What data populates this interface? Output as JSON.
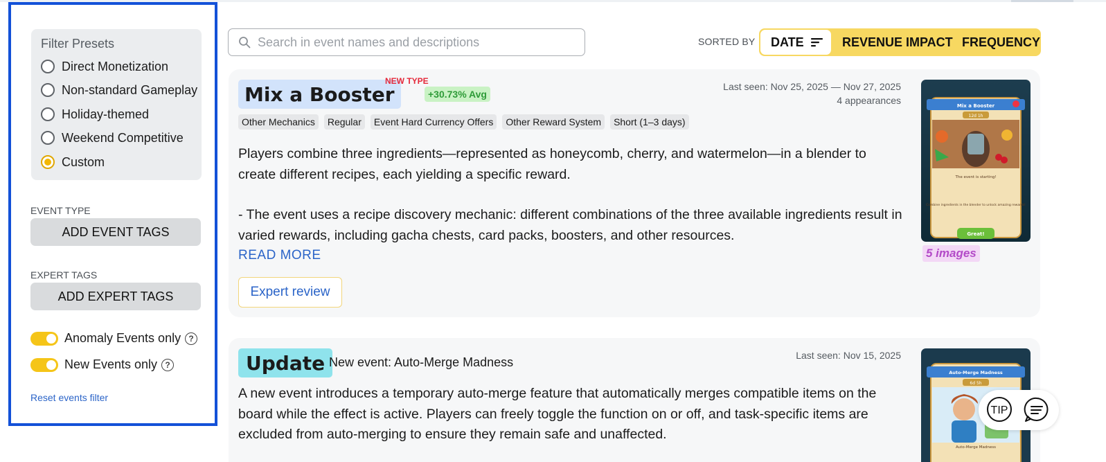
{
  "sidebar": {
    "presets_title": "Filter Presets",
    "presets": [
      {
        "label": "Direct Monetization",
        "checked": false
      },
      {
        "label": "Non-standard Gameplay",
        "checked": false
      },
      {
        "label": "Holiday-themed",
        "checked": false
      },
      {
        "label": "Weekend Competitive",
        "checked": false
      },
      {
        "label": "Custom",
        "checked": true
      }
    ],
    "event_type_label": "EVENT TYPE",
    "add_event_tags": "ADD EVENT TAGS",
    "expert_tags_label": "EXPERT TAGS",
    "add_expert_tags": "ADD EXPERT TAGS",
    "toggles": [
      {
        "label": "Anomaly Events only",
        "on": true
      },
      {
        "label": "New Events only",
        "on": true
      }
    ],
    "help_glyph": "?",
    "reset_link": "Reset events filter"
  },
  "search": {
    "placeholder": "Search in event names and descriptions",
    "value": ""
  },
  "sort": {
    "label": "SORTED BY",
    "options": [
      "DATE",
      "REVENUE IMPACT",
      "FREQUENCY"
    ],
    "active": "DATE"
  },
  "events": [
    {
      "title": "Mix a Booster",
      "badge": "NEW TYPE",
      "impact": "+30.73% Avg",
      "last_seen": "Last seen: Nov 25, 2025 — Nov 27, 2025",
      "appearances": "4 appearances",
      "tags": [
        "Other Mechanics",
        "Regular",
        "Event Hard Currency Offers",
        "Other Reward System",
        "Short (1–3 days)"
      ],
      "description_p1": "Players combine three ingredients—represented as honeycomb, cherry, and watermelon—in a blender to create different recipes, each yielding a specific reward.",
      "description_p2": "- The event uses a recipe discovery mechanic: different combinations of the three available ingredients result in varied rewards, including gacha chests, card packs, boosters, and other resources.",
      "read_more": "READ MORE",
      "expert_review": "Expert review",
      "images_count": "5 images",
      "thumb": {
        "header": "Mix a Booster",
        "timer": "12d 1h",
        "caption": "The event is starting!",
        "hint": "Combine ingredients in the blender to unlock amazing rewards!",
        "button": "Great!"
      }
    },
    {
      "title": "Update",
      "subtitle": "New event: Auto-Merge Madness",
      "last_seen": "Last seen: Nov 15, 2025",
      "description": "A new event introduces a temporary auto-merge feature that automatically merges compatible items on the board while the effect is active. Players can freely toggle the function on or off, and task-specific items are excluded from auto-merging to ensure they remain safe and unaffected.",
      "thumb": {
        "header": "Auto-Merge Madness",
        "timer": "6d 5h",
        "caption": "Auto-Merge Madness"
      }
    }
  ],
  "floating": {
    "tip": "TIP"
  },
  "colors": {
    "accent_yellow": "#f7d861",
    "sidebar_border": "#1351d8",
    "link_blue": "#2b64c8",
    "new_type_red": "#e5293a",
    "impact_green": "#2e9b38"
  }
}
